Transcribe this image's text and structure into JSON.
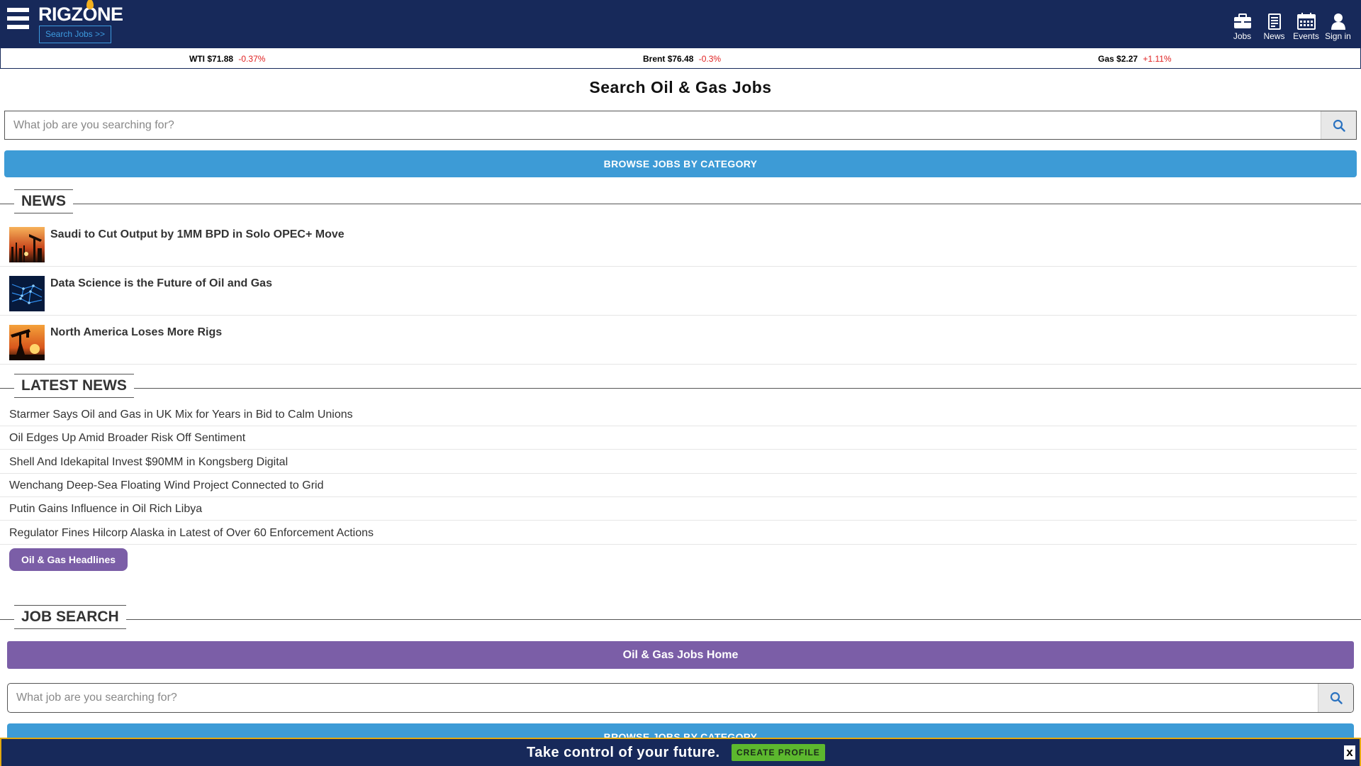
{
  "header": {
    "logo": "RIGZONE",
    "search_jobs_label": "Search Jobs >>",
    "nav": [
      {
        "label": "Jobs",
        "icon": "briefcase-icon"
      },
      {
        "label": "News",
        "icon": "news-icon"
      },
      {
        "label": "Events",
        "icon": "calendar-icon"
      },
      {
        "label": "Sign in",
        "icon": "user-icon"
      }
    ]
  },
  "ticker": [
    {
      "label": "WTI",
      "price": "$71.88",
      "change": "-0.37%"
    },
    {
      "label": "Brent",
      "price": "$76.48",
      "change": "-0.3%"
    },
    {
      "label": "Gas",
      "price": "$2.27",
      "change": "+1.11%"
    }
  ],
  "colors": {
    "header_bg": "#17295a",
    "accent_blue": "#3d9bd6",
    "accent_purple": "#7b5ea7",
    "accent_green": "#5cb82e",
    "accent_gold": "#e3a80e",
    "change_red": "#e02020"
  },
  "main": {
    "title": "Search Oil & Gas Jobs",
    "search_placeholder": "What job are you searching for?",
    "browse_label": "BROWSE JOBS BY CATEGORY"
  },
  "news": {
    "heading": "NEWS",
    "items": [
      {
        "title": "Saudi to Cut Output by 1MM BPD in Solo OPEC+ Move"
      },
      {
        "title": "Data Science is the Future of Oil and Gas"
      },
      {
        "title": "North America Loses More Rigs"
      }
    ]
  },
  "latest_news": {
    "heading": "LATEST NEWS",
    "items": [
      "Starmer Says Oil and Gas in UK Mix for Years in Bid to Calm Unions",
      "Oil Edges Up Amid Broader Risk Off Sentiment",
      "Shell And Idekapital Invest $90MM in Kongsberg Digital",
      "Wenchang Deep-Sea Floating Wind Project Connected to Grid",
      "Putin Gains Influence in Oil Rich Libya",
      "Regulator Fines Hilcorp Alaska in Latest of Over 60 Enforcement Actions"
    ],
    "headlines_button": "Oil & Gas Headlines"
  },
  "job_search": {
    "heading": "JOB SEARCH",
    "home_button": "Oil & Gas Jobs Home",
    "search_placeholder": "What job are you searching for?",
    "browse_label": "BROWSE JOBS BY CATEGORY"
  },
  "promo": {
    "text": "Take control of your future.",
    "button": "CREATE PROFILE",
    "close": "x"
  }
}
